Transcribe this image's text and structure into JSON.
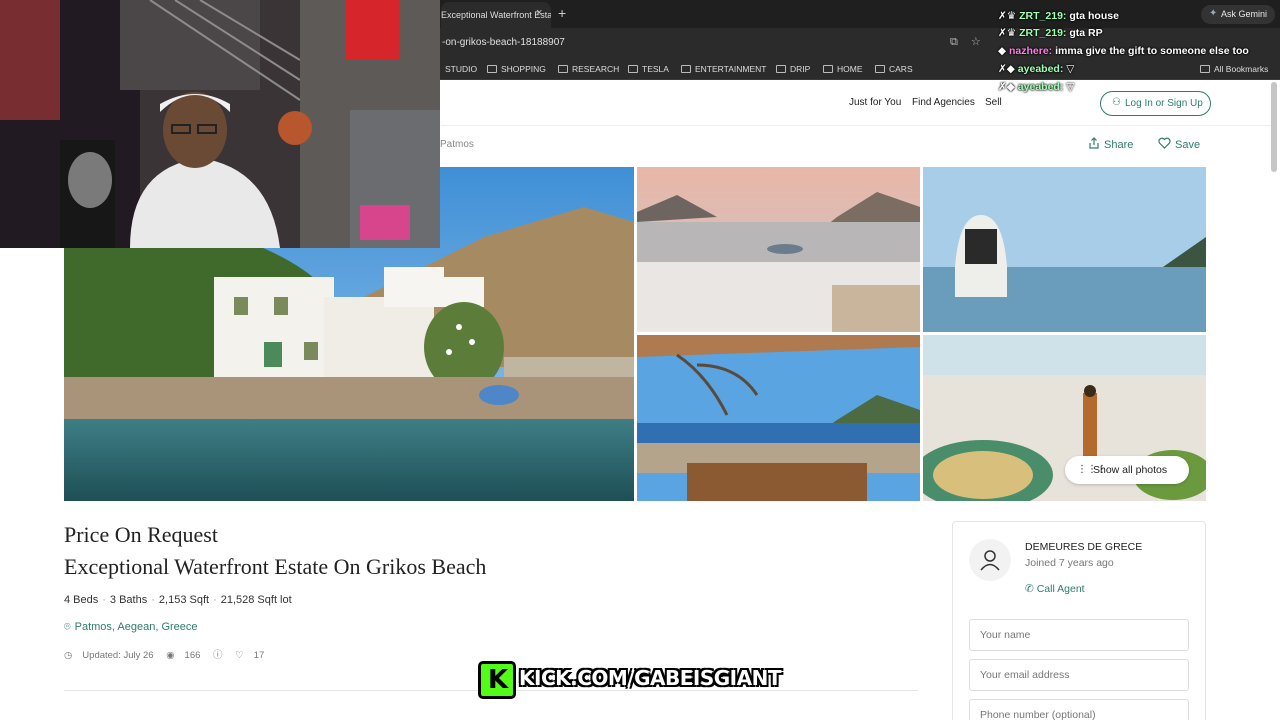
{
  "browser": {
    "tab_title": "Exceptional Waterfront Esta",
    "tab_close": "×",
    "new_tab": "+",
    "url": "-on-grikos-beach-18188907",
    "ask_gemini": "Ask Gemini",
    "bookmarks": [
      {
        "label": "STUDIO"
      },
      {
        "label": "SHOPPING"
      },
      {
        "label": "RESEARCH"
      },
      {
        "label": "TESLA"
      },
      {
        "label": "ENTERTAINMENT"
      },
      {
        "label": "DRIP"
      },
      {
        "label": "HOME"
      },
      {
        "label": "CARS"
      }
    ],
    "all_bookmarks": "All Bookmarks"
  },
  "site": {
    "nav": [
      "Just for You",
      "Find Agencies",
      "Sell"
    ],
    "login": "Log In or Sign Up",
    "breadcrumb": "Patmos",
    "share": "Share",
    "save": "Save",
    "show_all_photos": "Show all photos"
  },
  "listing": {
    "price": "Price On Request",
    "title": "Exceptional Waterfront Estate On Grikos Beach",
    "beds": "4 Beds",
    "baths": "3 Baths",
    "sqft": "2,153 Sqft",
    "lot": "21,528 Sqft lot",
    "location": "Patmos, Aegean, Greece",
    "updated": "Updated: July 26",
    "views": "166",
    "likes": "17"
  },
  "agent": {
    "name": "DEMEURES DE GRECE",
    "joined": "Joined 7 years ago",
    "call": "Call Agent",
    "fields": [
      "Your name",
      "Your email address",
      "Phone number (optional)"
    ]
  },
  "overlay": {
    "chat": [
      {
        "user": "ZRT_219:",
        "msg": "gta house"
      },
      {
        "user": "ZRT_219:",
        "msg": "gta RP"
      },
      {
        "user": "nazhere:",
        "msg": "imma give the gift to someone else too"
      },
      {
        "user": "ayeabed:",
        "msg": ""
      },
      {
        "user": "ayeabed:",
        "msg": ""
      }
    ],
    "kick_text": "KICK.COM/GABEISGIANT",
    "kick_logo": "K"
  },
  "colors": {
    "accent": "#2e7d6b",
    "kick_green": "#53fc18"
  }
}
